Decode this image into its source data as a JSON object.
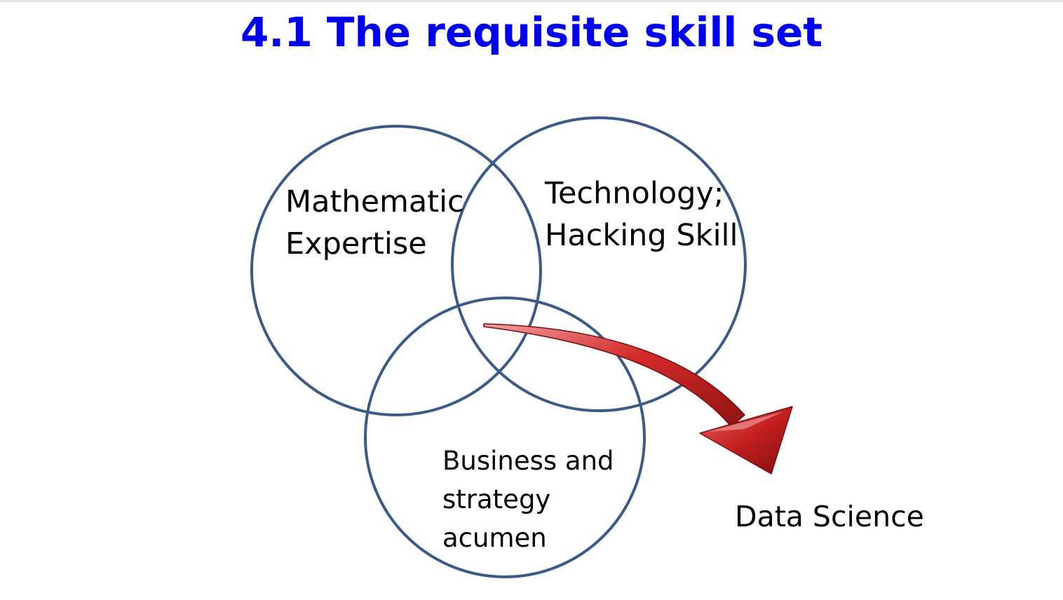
{
  "title": "4.1 The requisite skill set",
  "colors": {
    "title": "#0000f0",
    "circle_stroke": "#3a5b8a",
    "arrow_fill": "#d32a2a",
    "arrow_dark": "#8f1212",
    "arrow_light": "#f0a0a0",
    "text": "#000000"
  },
  "circles": [
    {
      "name": "mathematic-expertise",
      "lines": [
        "Mathematic",
        "Expertise"
      ]
    },
    {
      "name": "technology-hacking-skill",
      "lines": [
        "Technology;",
        "Hacking Skill"
      ]
    },
    {
      "name": "business-strategy-acumen",
      "lines": [
        "Business and",
        "strategy",
        "acumen"
      ]
    }
  ],
  "result_label": "Data Science"
}
